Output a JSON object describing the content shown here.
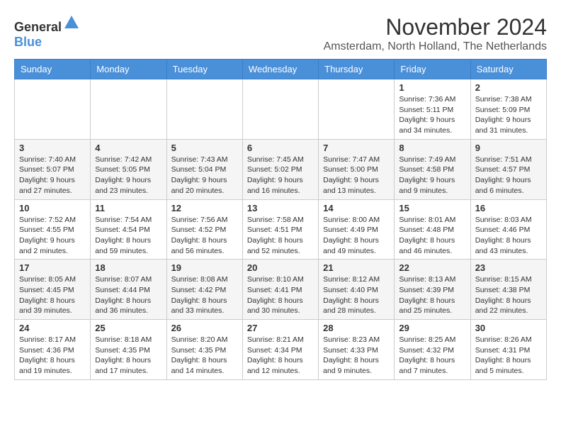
{
  "header": {
    "logo_general": "General",
    "logo_blue": "Blue",
    "month_title": "November 2024",
    "location": "Amsterdam, North Holland, The Netherlands"
  },
  "calendar": {
    "days_of_week": [
      "Sunday",
      "Monday",
      "Tuesday",
      "Wednesday",
      "Thursday",
      "Friday",
      "Saturday"
    ],
    "weeks": [
      [
        {
          "day": "",
          "info": ""
        },
        {
          "day": "",
          "info": ""
        },
        {
          "day": "",
          "info": ""
        },
        {
          "day": "",
          "info": ""
        },
        {
          "day": "",
          "info": ""
        },
        {
          "day": "1",
          "info": "Sunrise: 7:36 AM\nSunset: 5:11 PM\nDaylight: 9 hours and 34 minutes."
        },
        {
          "day": "2",
          "info": "Sunrise: 7:38 AM\nSunset: 5:09 PM\nDaylight: 9 hours and 31 minutes."
        }
      ],
      [
        {
          "day": "3",
          "info": "Sunrise: 7:40 AM\nSunset: 5:07 PM\nDaylight: 9 hours and 27 minutes."
        },
        {
          "day": "4",
          "info": "Sunrise: 7:42 AM\nSunset: 5:05 PM\nDaylight: 9 hours and 23 minutes."
        },
        {
          "day": "5",
          "info": "Sunrise: 7:43 AM\nSunset: 5:04 PM\nDaylight: 9 hours and 20 minutes."
        },
        {
          "day": "6",
          "info": "Sunrise: 7:45 AM\nSunset: 5:02 PM\nDaylight: 9 hours and 16 minutes."
        },
        {
          "day": "7",
          "info": "Sunrise: 7:47 AM\nSunset: 5:00 PM\nDaylight: 9 hours and 13 minutes."
        },
        {
          "day": "8",
          "info": "Sunrise: 7:49 AM\nSunset: 4:58 PM\nDaylight: 9 hours and 9 minutes."
        },
        {
          "day": "9",
          "info": "Sunrise: 7:51 AM\nSunset: 4:57 PM\nDaylight: 9 hours and 6 minutes."
        }
      ],
      [
        {
          "day": "10",
          "info": "Sunrise: 7:52 AM\nSunset: 4:55 PM\nDaylight: 9 hours and 2 minutes."
        },
        {
          "day": "11",
          "info": "Sunrise: 7:54 AM\nSunset: 4:54 PM\nDaylight: 8 hours and 59 minutes."
        },
        {
          "day": "12",
          "info": "Sunrise: 7:56 AM\nSunset: 4:52 PM\nDaylight: 8 hours and 56 minutes."
        },
        {
          "day": "13",
          "info": "Sunrise: 7:58 AM\nSunset: 4:51 PM\nDaylight: 8 hours and 52 minutes."
        },
        {
          "day": "14",
          "info": "Sunrise: 8:00 AM\nSunset: 4:49 PM\nDaylight: 8 hours and 49 minutes."
        },
        {
          "day": "15",
          "info": "Sunrise: 8:01 AM\nSunset: 4:48 PM\nDaylight: 8 hours and 46 minutes."
        },
        {
          "day": "16",
          "info": "Sunrise: 8:03 AM\nSunset: 4:46 PM\nDaylight: 8 hours and 43 minutes."
        }
      ],
      [
        {
          "day": "17",
          "info": "Sunrise: 8:05 AM\nSunset: 4:45 PM\nDaylight: 8 hours and 39 minutes."
        },
        {
          "day": "18",
          "info": "Sunrise: 8:07 AM\nSunset: 4:44 PM\nDaylight: 8 hours and 36 minutes."
        },
        {
          "day": "19",
          "info": "Sunrise: 8:08 AM\nSunset: 4:42 PM\nDaylight: 8 hours and 33 minutes."
        },
        {
          "day": "20",
          "info": "Sunrise: 8:10 AM\nSunset: 4:41 PM\nDaylight: 8 hours and 30 minutes."
        },
        {
          "day": "21",
          "info": "Sunrise: 8:12 AM\nSunset: 4:40 PM\nDaylight: 8 hours and 28 minutes."
        },
        {
          "day": "22",
          "info": "Sunrise: 8:13 AM\nSunset: 4:39 PM\nDaylight: 8 hours and 25 minutes."
        },
        {
          "day": "23",
          "info": "Sunrise: 8:15 AM\nSunset: 4:38 PM\nDaylight: 8 hours and 22 minutes."
        }
      ],
      [
        {
          "day": "24",
          "info": "Sunrise: 8:17 AM\nSunset: 4:36 PM\nDaylight: 8 hours and 19 minutes."
        },
        {
          "day": "25",
          "info": "Sunrise: 8:18 AM\nSunset: 4:35 PM\nDaylight: 8 hours and 17 minutes."
        },
        {
          "day": "26",
          "info": "Sunrise: 8:20 AM\nSunset: 4:35 PM\nDaylight: 8 hours and 14 minutes."
        },
        {
          "day": "27",
          "info": "Sunrise: 8:21 AM\nSunset: 4:34 PM\nDaylight: 8 hours and 12 minutes."
        },
        {
          "day": "28",
          "info": "Sunrise: 8:23 AM\nSunset: 4:33 PM\nDaylight: 8 hours and 9 minutes."
        },
        {
          "day": "29",
          "info": "Sunrise: 8:25 AM\nSunset: 4:32 PM\nDaylight: 8 hours and 7 minutes."
        },
        {
          "day": "30",
          "info": "Sunrise: 8:26 AM\nSunset: 4:31 PM\nDaylight: 8 hours and 5 minutes."
        }
      ]
    ]
  }
}
